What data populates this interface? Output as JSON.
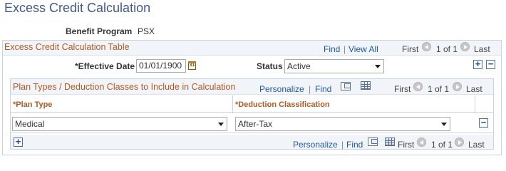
{
  "page": {
    "title": "Excess Credit Calculation"
  },
  "benefit_program": {
    "label": "Benefit Program",
    "value": "PSX"
  },
  "outer_section": {
    "title": "Excess Credit Calculation Table",
    "find": "Find",
    "separator": "|",
    "view_all": "View All",
    "first": "First",
    "count": "1 of 1",
    "last": "Last"
  },
  "fields": {
    "effective_date_label": "*Effective Date",
    "effective_date_value": "01/01/1900",
    "calendar_glyph": "31",
    "status_label": "Status",
    "status_value": "Active"
  },
  "inner_section": {
    "title": "Plan Types / Deduction Classes to Include in Calculation",
    "personalize": "Personalize",
    "separator": "|",
    "find": "Find",
    "first": "First",
    "count": "1 of 1",
    "last": "Last"
  },
  "grid": {
    "columns": [
      "*Plan Type",
      "*Deduction Classification"
    ],
    "rows": [
      {
        "plan_type": "Medical",
        "deduction_classification": "After-Tax"
      }
    ]
  },
  "footer": {
    "personalize": "Personalize",
    "separator": "|",
    "find": "Find",
    "first": "First",
    "count": "1 of 1",
    "last": "Last"
  },
  "buttons": {
    "add": "+",
    "delete": "−"
  },
  "icons": [
    "calendar-icon",
    "zoom-icon",
    "download-grid-icon",
    "nav-prev-icon",
    "nav-next-icon",
    "add-row-icon",
    "delete-row-icon"
  ],
  "colors": {
    "title": "#44598b",
    "section_title": "#b05a1f",
    "link": "#1c5aa6",
    "header_bg": "#f1f4f8",
    "border": "#c9d4e2"
  }
}
